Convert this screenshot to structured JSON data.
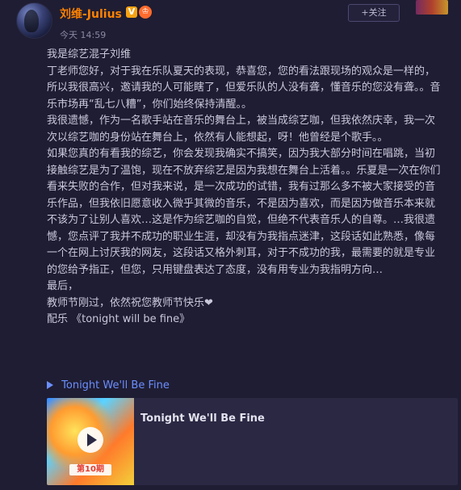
{
  "post": {
    "author": {
      "name": "刘维-Julius",
      "verified_badge": "V",
      "crown_badge": "♔"
    },
    "timestamp": "今天 14:59",
    "follow_label": "+关注",
    "content": "我是综艺混子刘维\n丁老师您好，对于我在乐队夏天的表现，恭喜您，您的看法跟现场的观众是一样的，所以我很高兴，邀请我的人可能瞎了，但爱乐队的人没有聋，懂音乐的您没有聋。。音乐市场再“乱七八糟”，你们始终保持清醒。。\n我很遗憾，作为一名歌手站在音乐的舞台上，被当成综艺咖，但我依然庆幸，我一次次以综艺咖的身份站在舞台上，依然有人能想起，呀！他曾经是个歌手。。\n如果您真的有看我的综艺，你会发现我确实不搞笑，因为我大部分时间在唱跳，当初接触综艺是为了温饱，现在不放弃综艺是因为我想在舞台上活着。。乐夏是一次在你们看来失败的合作，但对我来说，是一次成功的试错，我有过那么多不被大家接受的音乐作品，但我依旧愿意收入微乎其微的音乐，不是因为喜欢，而是因为做音乐本来就不该为了让别人喜欢…这是作为综艺咖的自觉，但绝不代表音乐人的自尊。…我很遗憾，您点评了我并不成功的职业生涯，却没有为我指点迷津，这段话如此熟悉，像每一个在网上讨厌我的网友，这段话又格外刺耳，对于不成功的我，最需要的就是专业的您给予指正，但您，只用键盘表达了态度，没有用专业为我指明方向…\n最后，\n教师节刚过，依然祝您教师节快乐❤\n配乐 《tonight will be fine》",
    "music_link": "Tonight We'll Be Fine",
    "card": {
      "title": "Tonight We'll Be Fine",
      "cover_episode": "第10期"
    }
  },
  "colors": {
    "background": "#1f1d33",
    "username": "#ff8200",
    "link": "#6b8fff",
    "card_background": "#2a2843"
  }
}
